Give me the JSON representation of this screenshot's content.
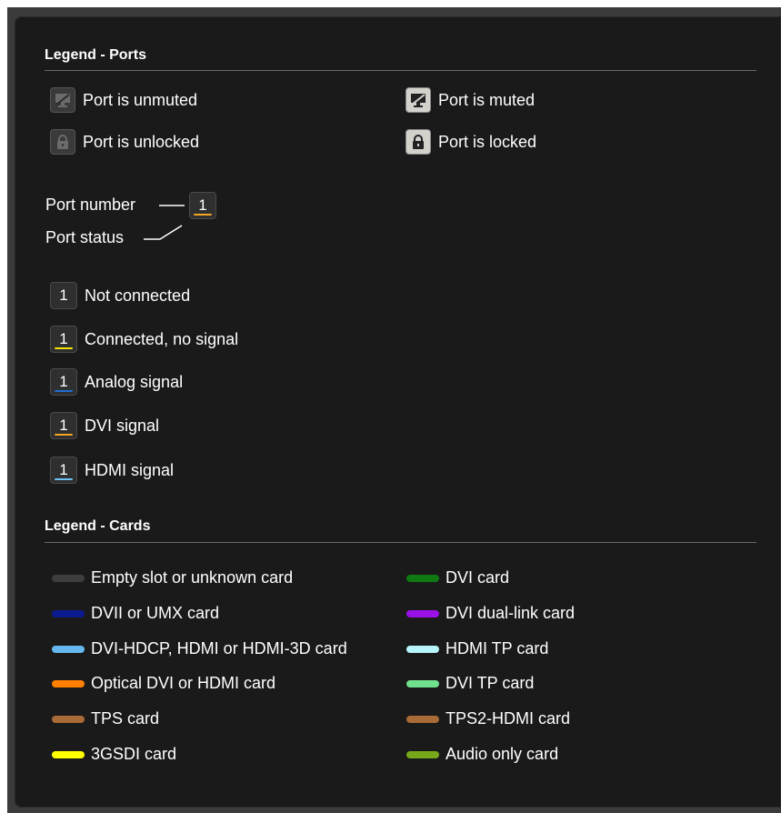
{
  "ports": {
    "heading": "Legend - Ports",
    "icons": [
      {
        "label": "Port is unmuted",
        "icon": "monitor-mute-icon",
        "state": "off"
      },
      {
        "label": "Port is muted",
        "icon": "monitor-mute-icon",
        "state": "on"
      },
      {
        "label": "Port is unlocked",
        "icon": "padlock-icon",
        "state": "off"
      },
      {
        "label": "Port is locked",
        "icon": "padlock-icon",
        "state": "on"
      }
    ],
    "diagram": {
      "port_number_label": "Port number",
      "port_status_label": "Port status",
      "number": "1",
      "status_color": "#f5a623"
    },
    "statuses": [
      {
        "number": "1",
        "label": "Not connected",
        "color": "#2f2f2f"
      },
      {
        "number": "1",
        "label": "Connected, no signal",
        "color": "#f2e400"
      },
      {
        "number": "1",
        "label": "Analog signal",
        "color": "#1e6fd0"
      },
      {
        "number": "1",
        "label": "DVI signal",
        "color": "#f5a623"
      },
      {
        "number": "1",
        "label": "HDMI signal",
        "color": "#6cc3f0"
      }
    ]
  },
  "cards": {
    "heading": "Legend - Cards",
    "left": [
      {
        "label": "Empty slot or unknown card",
        "color": "#3e3e3e"
      },
      {
        "label": "DVII or UMX card",
        "color": "#0b1a8f"
      },
      {
        "label": "DVI-HDCP, HDMI or HDMI-3D card",
        "color": "#67b7ef"
      },
      {
        "label": "Optical DVI or HDMI card",
        "color": "#ff7f00"
      },
      {
        "label": "TPS card",
        "color": "#a86a36"
      },
      {
        "label": "3GSDI card",
        "color": "#ffff00"
      }
    ],
    "right": [
      {
        "label": "DVI card",
        "color": "#0f7a12"
      },
      {
        "label": "DVI dual-link card",
        "color": "#9a11e8"
      },
      {
        "label": "HDMI TP card",
        "color": "#b7f5fb"
      },
      {
        "label": "DVI TP card",
        "color": "#6fe08c"
      },
      {
        "label": "TPS2-HDMI card",
        "color": "#a86a36"
      },
      {
        "label": "Audio only card",
        "color": "#76a81a"
      }
    ]
  }
}
